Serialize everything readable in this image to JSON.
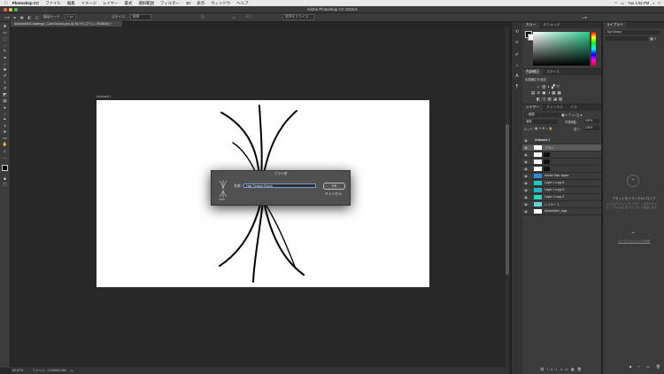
{
  "menubar": {
    "app_name": "Photoshop CC",
    "items": [
      "ファイル",
      "編集",
      "イメージ",
      "レイヤー",
      "書式",
      "選択範囲",
      "フィルター",
      "3D",
      "表示",
      "ウィンドウ",
      "ヘルプ"
    ],
    "clock": "Tue 1:52 PM"
  },
  "window": {
    "title": "Adobe Photoshop CC 2015.5"
  },
  "options": {
    "mode_label": "描画モード",
    "size_value": "0 px",
    "style_label": "スタイル：",
    "style_value": "標準",
    "refine_button": "境界をスライス…"
  },
  "document": {
    "tab": "AdobeMAXChallenge_CoreTutorial.psd @ 66.7% (ブラシ, RGB/8#) *",
    "artboard_label": "Artboard 1",
    "zoom": "66.67%",
    "doc_info": "ファイル : 2.00M/42.5M"
  },
  "dialog": {
    "title": "ブラシ名",
    "name_label": "名前：",
    "name_value": "Hair Texture Brush",
    "ok_label": "OK",
    "cancel_label": "キャンセル",
    "brush_size": "1800"
  },
  "color_panel": {
    "tabs": [
      "カラー",
      "スウォッチ"
    ]
  },
  "adjust_panel": {
    "tabs": [
      "色調補正",
      "スタイル"
    ],
    "hint": "色調補正を追加"
  },
  "layers_panel": {
    "tabs": [
      "レイヤー",
      "チャンネル",
      "パス"
    ],
    "kind_label": "種類",
    "blend_mode": "通常",
    "opacity_label": "不透明度：",
    "opacity_value": "100%",
    "lock_label": "ロック：",
    "fill_label": "塗り：",
    "fill_value": "100%",
    "layers": [
      {
        "name": "Artboard 1",
        "thumb": "#444444"
      },
      {
        "name": "ブラシ",
        "thumb": "#ffffff"
      },
      {
        "name": "",
        "thumb": "#ffffff"
      },
      {
        "name": "",
        "thumb": "#ffffff"
      },
      {
        "name": "",
        "thumb": "#ffffff"
      },
      {
        "name": "Adobe Max Japan",
        "thumb": "#2f8ddc"
      },
      {
        "name": "Layer 1 copy 8",
        "thumb": "#1fc8c0"
      },
      {
        "name": "Layer 1 copy 9",
        "thumb": "#22b7c6"
      },
      {
        "name": "Layer 1 copy 4",
        "thumb": "#2dd3c2"
      },
      {
        "name": "レイヤー 1",
        "thumb": "#5fd6d2"
      },
      {
        "name": "AdobeMAX_logo",
        "thumb": "#ffffff"
      }
    ]
  },
  "library_panel": {
    "tabs": [
      "ライブラリ"
    ],
    "library_name": "My Library",
    "drop_hint": "アセットをドラッグ&ドロップ",
    "drop_desc": "ここにグラフィック、カラー、文字スタイル、ブラシなどをドラッグして追加します。",
    "footer_link": "ライブラリについての詳細"
  },
  "colors": {
    "accent": "#7a9bd6",
    "gradient_top": "#2ecc8f"
  }
}
